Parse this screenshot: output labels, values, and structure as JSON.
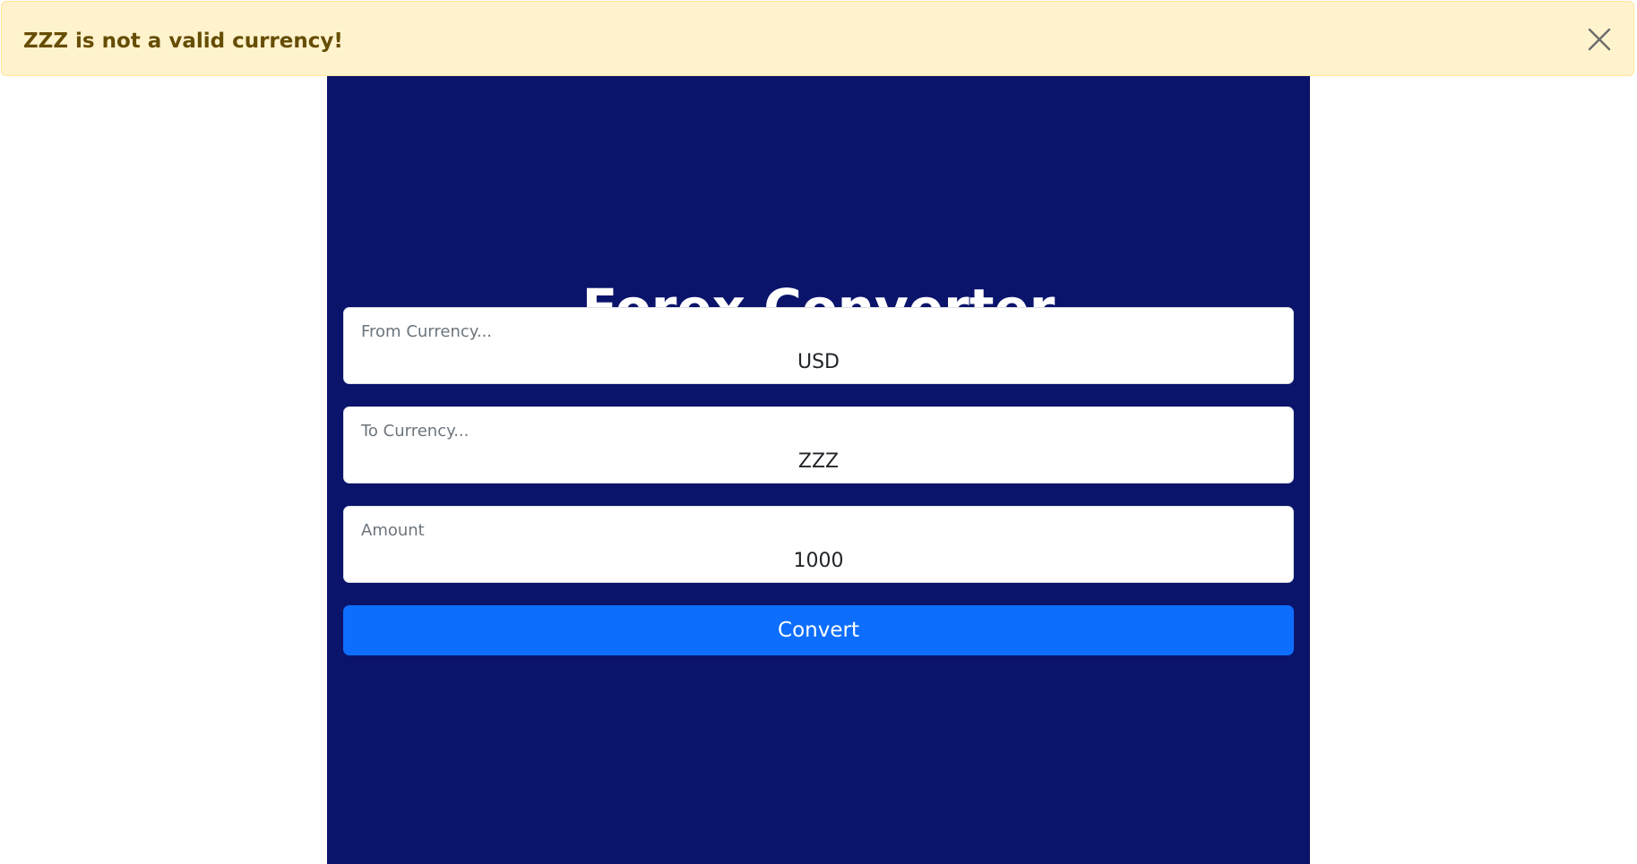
{
  "alert": {
    "message": "ZZZ is not a valid currency!",
    "close_icon": "close-icon"
  },
  "header": {
    "title": "Forex Converter"
  },
  "form": {
    "from_currency": {
      "label": "From Currency...",
      "value": "USD"
    },
    "to_currency": {
      "label": "To Currency...",
      "value": "ZZZ"
    },
    "amount": {
      "label": "Amount",
      "value": "1000"
    },
    "submit_label": "Convert"
  },
  "colors": {
    "panel_background": "#0b146b",
    "alert_background": "#fff3cd",
    "alert_text": "#664d03",
    "button_primary": "#0d6efd"
  }
}
